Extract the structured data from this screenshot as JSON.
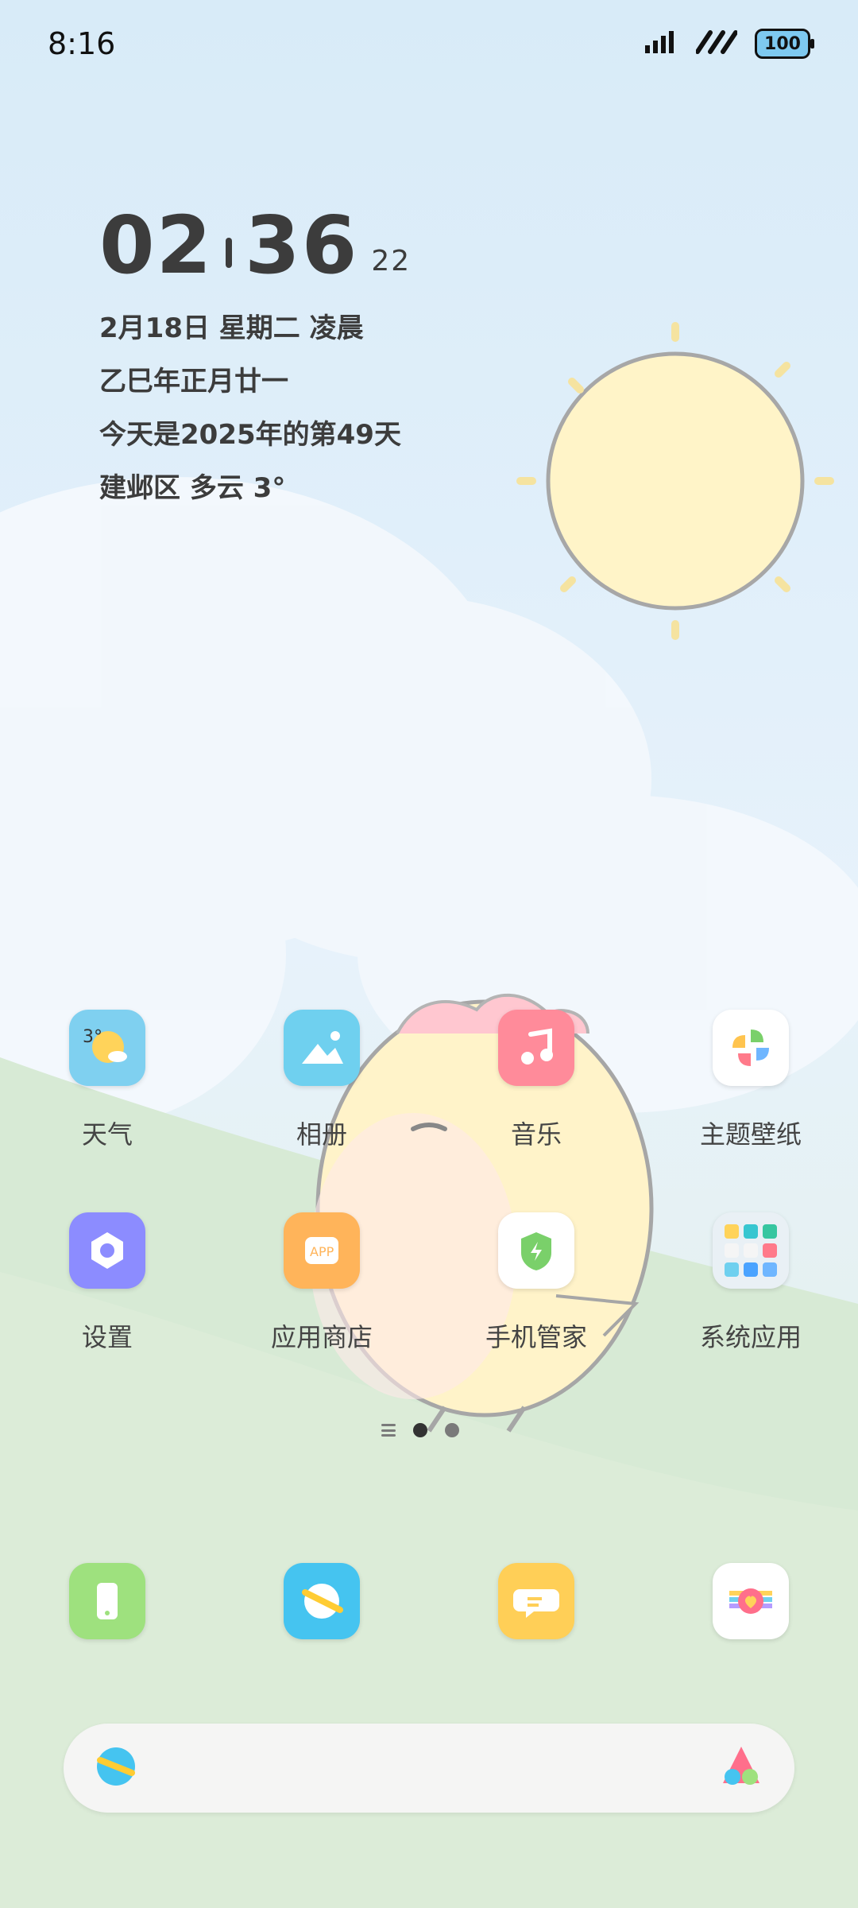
{
  "status": {
    "time": "8:16",
    "battery": "100"
  },
  "clock": {
    "hours": "02",
    "minutes": "36",
    "seconds": "22",
    "date_line": "2月18日 星期二 凌晨",
    "lunar_line": "乙巳年正月廿一",
    "day_of_year": "今天是2025年的第49天",
    "weather": "建邺区 多云 3°"
  },
  "apps_row1": [
    {
      "label": "天气"
    },
    {
      "label": "相册"
    },
    {
      "label": "音乐"
    },
    {
      "label": "主题壁纸"
    }
  ],
  "apps_row2": [
    {
      "label": "设置"
    },
    {
      "label": "应用商店"
    },
    {
      "label": "手机管家"
    },
    {
      "label": "系统应用"
    }
  ],
  "dock": [
    {
      "name": "phone"
    },
    {
      "name": "browser"
    },
    {
      "name": "messages"
    },
    {
      "name": "mimoji-heart"
    }
  ],
  "search": {
    "placeholder": ""
  },
  "weather_icon_temp": "3°",
  "appstore_badge": "APP"
}
